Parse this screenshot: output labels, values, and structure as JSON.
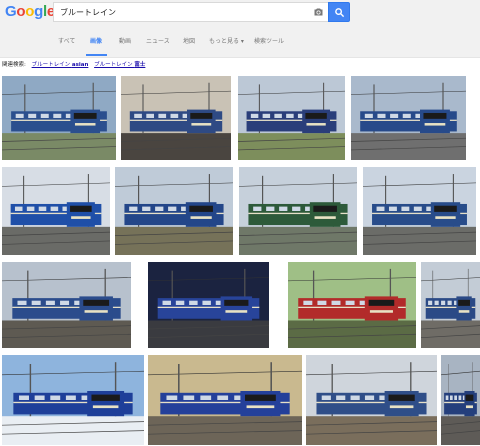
{
  "logo": {
    "letters": [
      "G",
      "o",
      "o",
      "g",
      "l",
      "e"
    ],
    "colors": [
      "#4285f4",
      "#ea4335",
      "#fbbc05",
      "#4285f4",
      "#34a853",
      "#ea4335"
    ]
  },
  "search": {
    "query": "ブルートレイン"
  },
  "tabs": [
    {
      "label": "すべて",
      "active": false
    },
    {
      "label": "画像",
      "active": true
    },
    {
      "label": "動画",
      "active": false
    },
    {
      "label": "ニュース",
      "active": false
    },
    {
      "label": "地図",
      "active": false
    },
    {
      "label": "もっと見る ▾",
      "active": false
    },
    {
      "label": "検索ツール",
      "active": false
    }
  ],
  "related": {
    "label": "関連検索:",
    "items": [
      {
        "prefix": "ブルートレイン ",
        "bold": "asian"
      },
      {
        "prefix": "ブルートレイン ",
        "bold": "富士"
      }
    ]
  },
  "colors": {
    "accent": "#4285f4",
    "link": "#1a0dab"
  },
  "results": [
    {
      "desc": "blue train EF66 locomotive"
    },
    {
      "desc": "EF66 at crowded platform"
    },
    {
      "desc": "EF66 blue train in countryside"
    },
    {
      "desc": "blue train under catenary"
    },
    {
      "desc": "blue train passing"
    },
    {
      "desc": "blue sleeper car close-up"
    },
    {
      "desc": "EF65 blue train"
    },
    {
      "desc": "Twilight Express"
    },
    {
      "desc": "blue train round nose"
    },
    {
      "desc": "EF66 with blue coaches"
    },
    {
      "desc": "blue train at night platform"
    },
    {
      "desc": "red EF81 locomotive"
    },
    {
      "desc": "EF66 at station"
    },
    {
      "desc": "blue train with mountain"
    },
    {
      "desc": "blue sleeper coach side"
    },
    {
      "desc": "train at depot"
    },
    {
      "desc": "blue train small"
    }
  ]
}
